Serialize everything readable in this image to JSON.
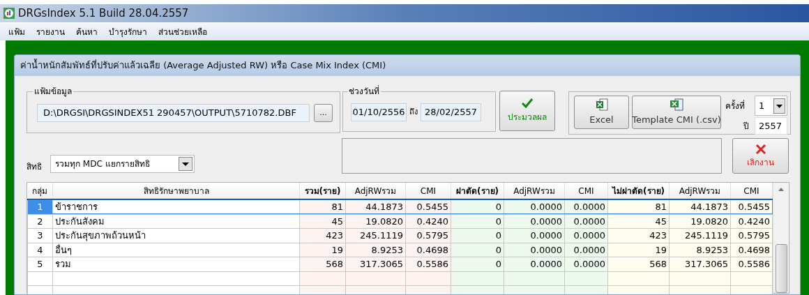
{
  "window": {
    "title": "DRGsIndex 5.1 Build 28.04.2557"
  },
  "menu": [
    "แฟ้ม",
    "รายงาน",
    "ค้นหา",
    "บำรุงรักษา",
    "ส่วนช่วยเหลือ"
  ],
  "dialog": {
    "title": "ค่าน้ำหนักสัมพัทธ์ที่ปรับค่าแล้วเฉลีย (Average Adjusted RW) หรือ Case Mix Index (CMI)",
    "file_group": {
      "label": "แฟ้มข้อมูล",
      "path": "D:\\DRGSI\\DRGSINDEX51 290457\\OUTPUT\\5710782.DBF",
      "browse": "..."
    },
    "date_group": {
      "label": "ช่วงวันที่",
      "from": "01/10/2556",
      "to_label": "ถึง",
      "to": "28/02/2557"
    },
    "process_button": "ประมวลผล",
    "export": {
      "excel": "Excel",
      "template": "Template CMI (.csv)",
      "round_label": "ครั้งที่",
      "round": "1",
      "year_label": "ปี",
      "year": "2557"
    },
    "cancel_button": "เลิกงาน",
    "right_select": {
      "label": "สิทธิ",
      "value": "รวมทุก MDC แยกรายสิทธิ"
    },
    "table": {
      "columns": [
        {
          "label": "กลุ่ม",
          "kind": "base",
          "bold": false
        },
        {
          "label": "สิทธิรักษาพยาบาล",
          "kind": "base",
          "bold": false
        },
        {
          "label": "รวม(ราย)",
          "kind": "total",
          "bold": true
        },
        {
          "label": "AdjRWรวม",
          "kind": "total",
          "bold": false
        },
        {
          "label": "CMI",
          "kind": "total",
          "bold": false
        },
        {
          "label": "ผ่าตัด(ราย)",
          "kind": "surgery",
          "bold": true
        },
        {
          "label": "AdjRWรวม",
          "kind": "surgery",
          "bold": false
        },
        {
          "label": "CMI",
          "kind": "surgery",
          "bold": false
        },
        {
          "label": "ไม่ผ่าตัด(ราย)",
          "kind": "nonsurgery",
          "bold": true
        },
        {
          "label": "AdjRWรวม",
          "kind": "nonsurgery",
          "bold": false
        },
        {
          "label": "CMI",
          "kind": "nonsurgery",
          "bold": false
        }
      ],
      "rows": [
        {
          "selected": true,
          "cells": [
            "1",
            "ข้าราชการ",
            "81",
            "44.1873",
            "0.5455",
            "0",
            "0.0000",
            "0.0000",
            "81",
            "44.1873",
            "0.5455"
          ]
        },
        {
          "selected": false,
          "cells": [
            "2",
            "ประกันสังคม",
            "45",
            "19.0820",
            "0.4240",
            "0",
            "0.0000",
            "0.0000",
            "45",
            "19.0820",
            "0.4240"
          ]
        },
        {
          "selected": false,
          "cells": [
            "3",
            "ประกันสุขภาพถ้วนหน้า",
            "423",
            "245.1119",
            "0.5795",
            "0",
            "0.0000",
            "0.0000",
            "423",
            "245.1119",
            "0.5795"
          ]
        },
        {
          "selected": false,
          "cells": [
            "4",
            "อื่นๆ",
            "19",
            "8.9253",
            "0.4698",
            "0",
            "0.0000",
            "0.0000",
            "19",
            "8.9253",
            "0.4698"
          ]
        },
        {
          "selected": false,
          "cells": [
            "5",
            "รวม",
            "568",
            "317.3065",
            "0.5586",
            "0",
            "0.0000",
            "0.0000",
            "568",
            "317.3065",
            "0.5586"
          ]
        }
      ]
    }
  }
}
